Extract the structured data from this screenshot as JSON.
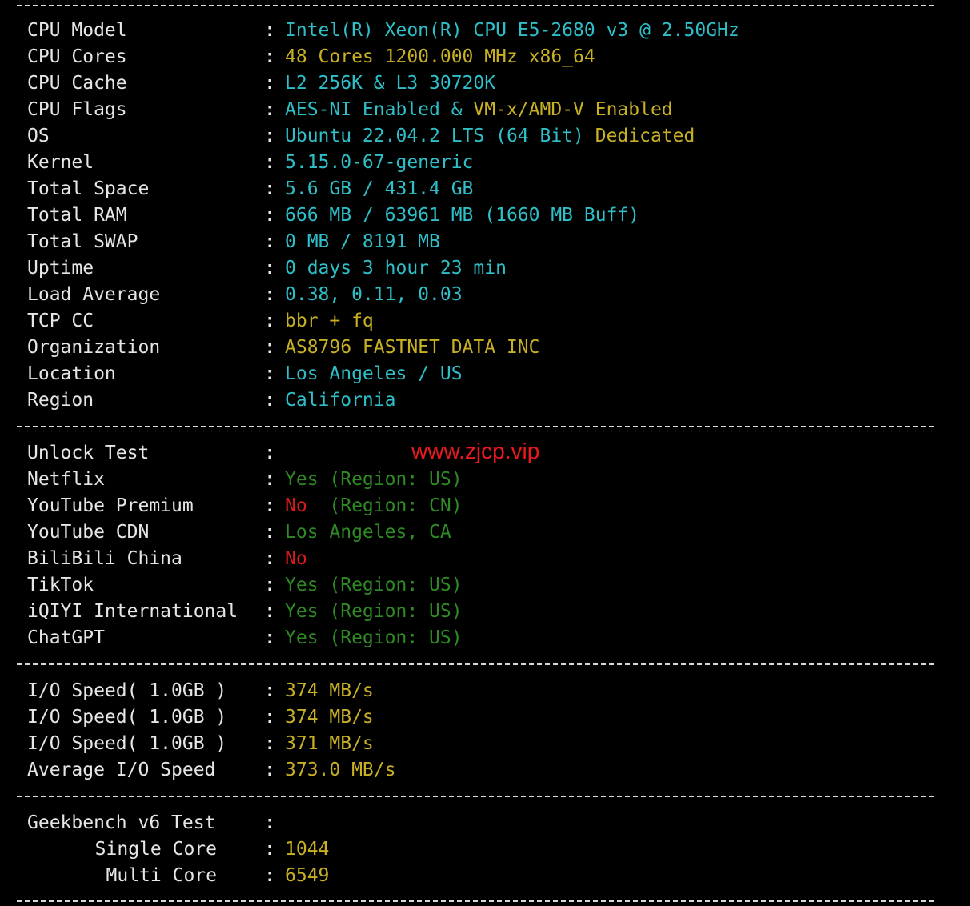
{
  "sysinfo": [
    {
      "label": "CPU Model",
      "parts": [
        {
          "text": "Intel(R) Xeon(R) CPU E5-2680 v3 @ 2.50GHz",
          "color": "cyan"
        }
      ]
    },
    {
      "label": "CPU Cores",
      "parts": [
        {
          "text": "48 Cores 1200.000 MHz x86_64",
          "color": "yellow"
        }
      ]
    },
    {
      "label": "CPU Cache",
      "parts": [
        {
          "text": "L2 256K & L3 30720K",
          "color": "cyan"
        }
      ]
    },
    {
      "label": "CPU Flags",
      "parts": [
        {
          "text": "AES-NI Enabled & ",
          "color": "cyan"
        },
        {
          "text": "VM-x/AMD-V Enabled",
          "color": "yellow"
        }
      ]
    },
    {
      "label": "OS",
      "parts": [
        {
          "text": "Ubuntu 22.04.2 LTS (64 Bit) ",
          "color": "cyan"
        },
        {
          "text": "Dedicated",
          "color": "yellow"
        }
      ]
    },
    {
      "label": "Kernel",
      "parts": [
        {
          "text": "5.15.0-67-generic",
          "color": "cyan"
        }
      ]
    },
    {
      "label": "Total Space",
      "parts": [
        {
          "text": "5.6 GB / 431.4 GB",
          "color": "cyan"
        }
      ]
    },
    {
      "label": "Total RAM",
      "parts": [
        {
          "text": "666 MB / 63961 MB (1660 MB Buff)",
          "color": "cyan"
        }
      ]
    },
    {
      "label": "Total SWAP",
      "parts": [
        {
          "text": "0 MB / 8191 MB",
          "color": "cyan"
        }
      ]
    },
    {
      "label": "Uptime",
      "parts": [
        {
          "text": "0 days 3 hour 23 min",
          "color": "cyan"
        }
      ]
    },
    {
      "label": "Load Average",
      "parts": [
        {
          "text": "0.38, 0.11, 0.03",
          "color": "cyan"
        }
      ]
    },
    {
      "label": "TCP CC",
      "parts": [
        {
          "text": "bbr + fq",
          "color": "yellow"
        }
      ]
    },
    {
      "label": "Organization",
      "parts": [
        {
          "text": "AS8796 FASTNET DATA INC",
          "color": "yellow"
        }
      ]
    },
    {
      "label": "Location",
      "parts": [
        {
          "text": "Los Angeles / US",
          "color": "cyan"
        }
      ]
    },
    {
      "label": "Region",
      "parts": [
        {
          "text": "California",
          "color": "cyan"
        }
      ]
    }
  ],
  "unlock": [
    {
      "label": "Unlock Test",
      "parts": []
    },
    {
      "label": "Netflix",
      "parts": [
        {
          "text": "Yes (Region: US)",
          "color": "green"
        }
      ]
    },
    {
      "label": "YouTube Premium",
      "parts": [
        {
          "text": "No ",
          "color": "red"
        },
        {
          "text": " (Region: CN)",
          "color": "green"
        }
      ]
    },
    {
      "label": "YouTube CDN",
      "parts": [
        {
          "text": "Los Angeles, CA",
          "color": "green"
        }
      ]
    },
    {
      "label": "BiliBili China",
      "parts": [
        {
          "text": "No",
          "color": "red"
        }
      ]
    },
    {
      "label": "TikTok",
      "parts": [
        {
          "text": "Yes (Region: US)",
          "color": "green"
        }
      ]
    },
    {
      "label": "iQIYI International",
      "parts": [
        {
          "text": "Yes (Region: US)",
          "color": "green"
        }
      ]
    },
    {
      "label": "ChatGPT",
      "parts": [
        {
          "text": "Yes (Region: US)",
          "color": "green"
        }
      ]
    }
  ],
  "io": [
    {
      "label": "I/O Speed( 1.0GB )",
      "parts": [
        {
          "text": "374 MB/s",
          "color": "yellow"
        }
      ]
    },
    {
      "label": "I/O Speed( 1.0GB )",
      "parts": [
        {
          "text": "374 MB/s",
          "color": "yellow"
        }
      ]
    },
    {
      "label": "I/O Speed( 1.0GB )",
      "parts": [
        {
          "text": "371 MB/s",
          "color": "yellow"
        }
      ]
    },
    {
      "label": "Average I/O Speed",
      "parts": [
        {
          "text": "373.0 MB/s",
          "color": "yellow"
        }
      ]
    }
  ],
  "geekbench": [
    {
      "label": "Geekbench v6 Test",
      "parts": []
    },
    {
      "label": "Single Core",
      "parts": [
        {
          "text": "1044",
          "color": "yellow"
        }
      ]
    },
    {
      "label": "Multi Core",
      "parts": [
        {
          "text": "6549",
          "color": "yellow"
        }
      ]
    }
  ],
  "colon": ":",
  "watermark": "www.zjcp.vip",
  "colors": {
    "background": "#000000",
    "label": "#e6e6e6",
    "cyan": "#2ebfc8",
    "yellow": "#c8b024",
    "green": "#2f8a25",
    "red": "#d81a1a",
    "watermark": "#e8191f"
  }
}
